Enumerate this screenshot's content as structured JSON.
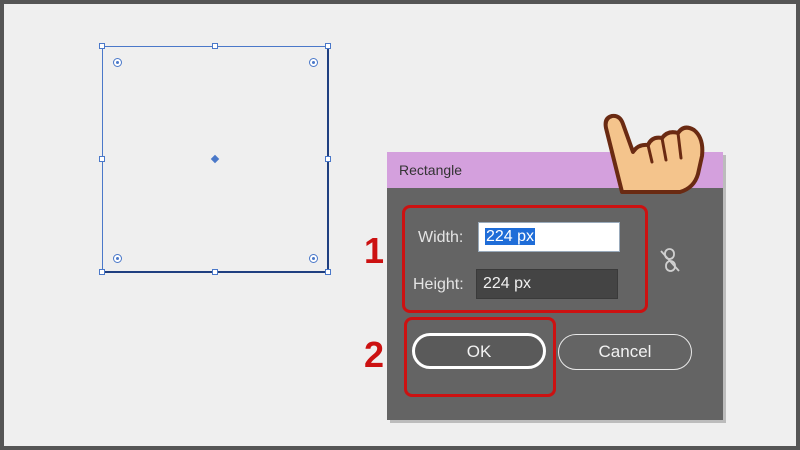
{
  "dialog": {
    "title": "Rectangle",
    "width_label": "Width:",
    "width_value": "224 px",
    "height_label": "Height:",
    "height_value": "224 px",
    "ok_label": "OK",
    "cancel_label": "Cancel",
    "constrain_icon": "unlink-chain-icon"
  },
  "annotations": {
    "step1": "1",
    "step2": "2",
    "color": "#cc1111"
  },
  "colors": {
    "titlebar": "#d4a0dd",
    "dialog_bg": "#646464",
    "selection": "#4a78c9"
  }
}
